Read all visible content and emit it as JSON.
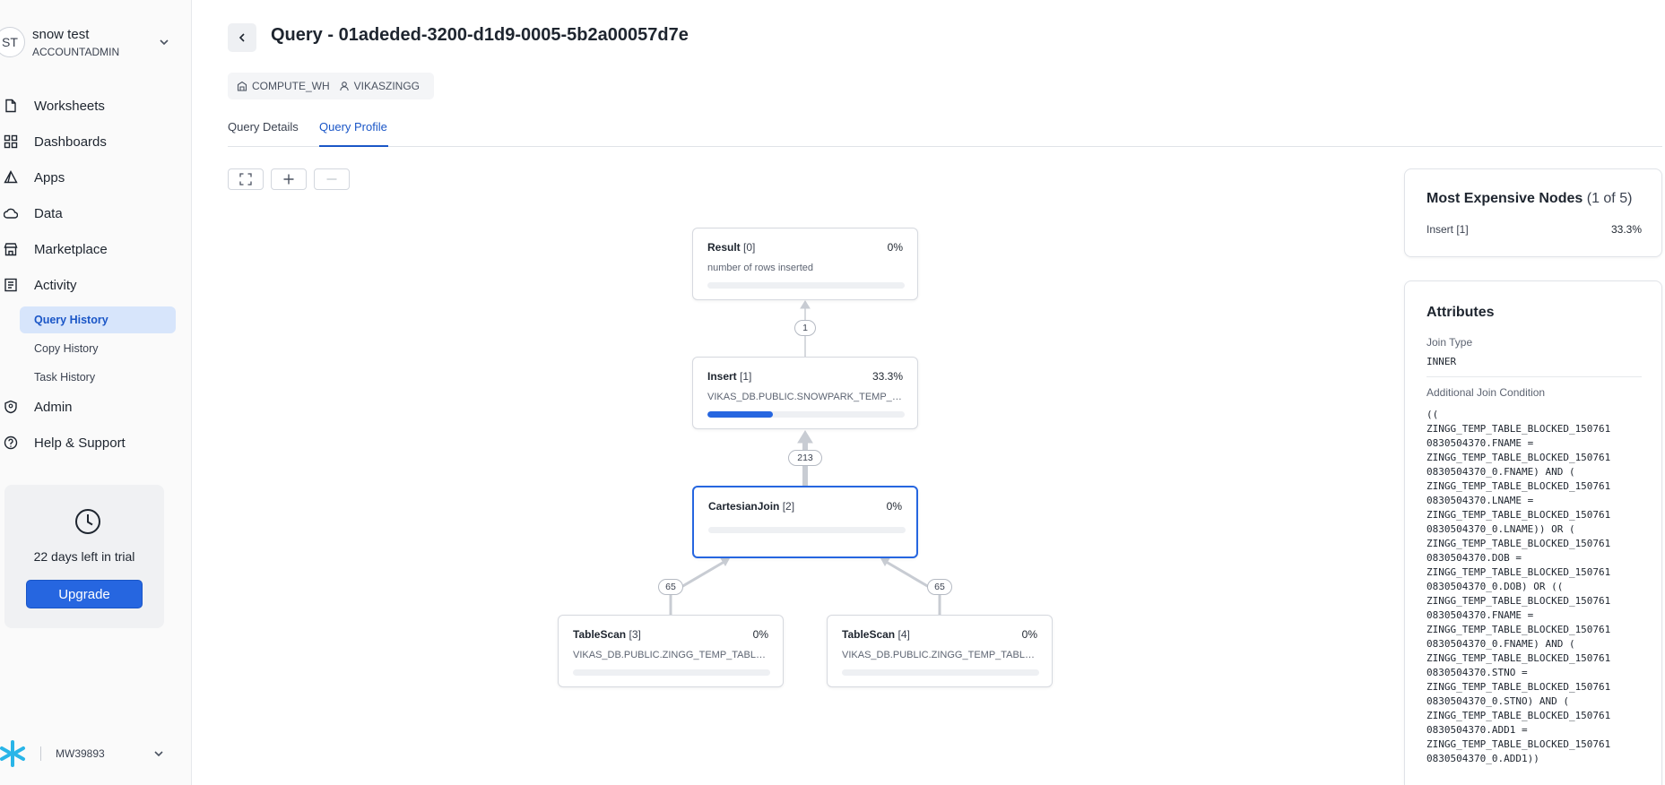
{
  "sidebar": {
    "user": {
      "initials": "ST",
      "name": "snow test",
      "role": "ACCOUNTADMIN"
    },
    "nav": [
      {
        "label": "Worksheets",
        "icon": "worksheet-icon"
      },
      {
        "label": "Dashboards",
        "icon": "dashboard-icon"
      },
      {
        "label": "Apps",
        "icon": "apps-icon"
      },
      {
        "label": "Data",
        "icon": "cloud-icon"
      },
      {
        "label": "Marketplace",
        "icon": "store-icon"
      },
      {
        "label": "Activity",
        "icon": "activity-icon"
      }
    ],
    "activity_sub": [
      "Query History",
      "Copy History",
      "Task History"
    ],
    "nav_bottom": [
      {
        "label": "Admin",
        "icon": "admin-icon"
      },
      {
        "label": "Help & Support",
        "icon": "help-icon"
      }
    ],
    "trial": {
      "text": "22 days left in trial",
      "button": "Upgrade"
    },
    "account": "MW39893"
  },
  "header": {
    "title": "Query - 01adeded-3200-d1d9-0005-5b2a00057d7e",
    "warehouse": "COMPUTE_WH",
    "user": "VIKASZINGG",
    "tabs": [
      "Query Details",
      "Query Profile"
    ],
    "active_tab": "Query Profile"
  },
  "graph": {
    "nodes": [
      {
        "name": "Result",
        "id": "[0]",
        "pct": "0%",
        "sub": "number of rows inserted",
        "fill": 0
      },
      {
        "name": "Insert",
        "id": "[1]",
        "pct": "33.3%",
        "sub": "VIKAS_DB.PUBLIC.SNOWPARK_TEMP_TABLE",
        "fill": 0.333
      },
      {
        "name": "CartesianJoin",
        "id": "[2]",
        "pct": "0%",
        "sub": "",
        "fill": 0
      },
      {
        "name": "TableScan",
        "id": "[3]",
        "pct": "0%",
        "sub": "VIKAS_DB.PUBLIC.ZINGG_TEMP_TABLE_BLOCKED",
        "fill": 0
      },
      {
        "name": "TableScan",
        "id": "[4]",
        "pct": "0%",
        "sub": "VIKAS_DB.PUBLIC.ZINGG_TEMP_TABLE_BLOCKED",
        "fill": 0
      }
    ],
    "edges": [
      "1",
      "213",
      "65",
      "65"
    ]
  },
  "expensive": {
    "title": "Most Expensive Nodes",
    "count": "(1 of 5)",
    "items": [
      {
        "name": "Insert [1]",
        "pct": "33.3%"
      }
    ]
  },
  "attributes": {
    "title": "Attributes",
    "join_type_label": "Join Type",
    "join_type": "INNER",
    "condition_label": "Additional Join Condition",
    "condition": "((\nZINGG_TEMP_TABLE_BLOCKED_150761\n0830504370.FNAME =\nZINGG_TEMP_TABLE_BLOCKED_150761\n0830504370_0.FNAME) AND (\nZINGG_TEMP_TABLE_BLOCKED_150761\n0830504370.LNAME =\nZINGG_TEMP_TABLE_BLOCKED_150761\n0830504370_0.LNAME)) OR (\nZINGG_TEMP_TABLE_BLOCKED_150761\n0830504370.DOB =\nZINGG_TEMP_TABLE_BLOCKED_150761\n0830504370_0.DOB) OR ((\nZINGG_TEMP_TABLE_BLOCKED_150761\n0830504370.FNAME =\nZINGG_TEMP_TABLE_BLOCKED_150761\n0830504370_0.FNAME) AND (\nZINGG_TEMP_TABLE_BLOCKED_150761\n0830504370.STNO =\nZINGG_TEMP_TABLE_BLOCKED_150761\n0830504370_0.STNO) AND (\nZINGG_TEMP_TABLE_BLOCKED_150761\n0830504370.ADD1 =\nZINGG_TEMP_TABLE_BLOCKED_150761\n0830504370_0.ADD1))"
  },
  "colors": {
    "accent": "#2666e0",
    "active_bg": "#d7e5fb",
    "snowflake": "#29b5e8"
  }
}
